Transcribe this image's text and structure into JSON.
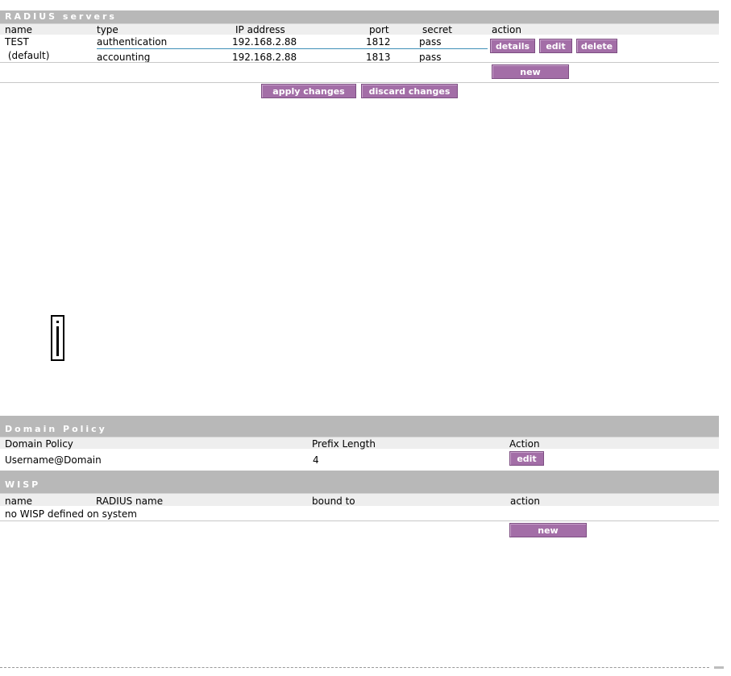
{
  "radius": {
    "title": "RADIUS servers",
    "headers": {
      "name": "name",
      "type": "type",
      "ip": "IP address",
      "port": "port",
      "secret": "secret",
      "action": "action"
    },
    "rows": [
      {
        "name": "TEST",
        "type": "authentication",
        "ip": "192.168.2.88",
        "port": "1812",
        "secret": "pass"
      },
      {
        "name": " (default)",
        "type": "accounting",
        "ip": "192.168.2.88",
        "port": "1813",
        "secret": "pass"
      }
    ],
    "buttons": {
      "details": "details",
      "edit": "edit",
      "delete": "delete",
      "new": "new"
    }
  },
  "changes": {
    "apply": "apply changes",
    "discard": "discard changes"
  },
  "info_icon": "info-icon",
  "domain_policy": {
    "title": "Domain Policy",
    "headers": {
      "policy": "Domain Policy",
      "prefix": "Prefix Length",
      "action": "Action"
    },
    "row": {
      "policy": "Username@Domain",
      "prefix": "4"
    },
    "buttons": {
      "edit": "edit"
    }
  },
  "wisp": {
    "title": "WISP",
    "headers": {
      "name": "name",
      "radius_name": "RADIUS name",
      "bound_to": "bound to",
      "action": "action"
    },
    "empty_message": "no WISP defined on system",
    "buttons": {
      "new": "new"
    }
  }
}
